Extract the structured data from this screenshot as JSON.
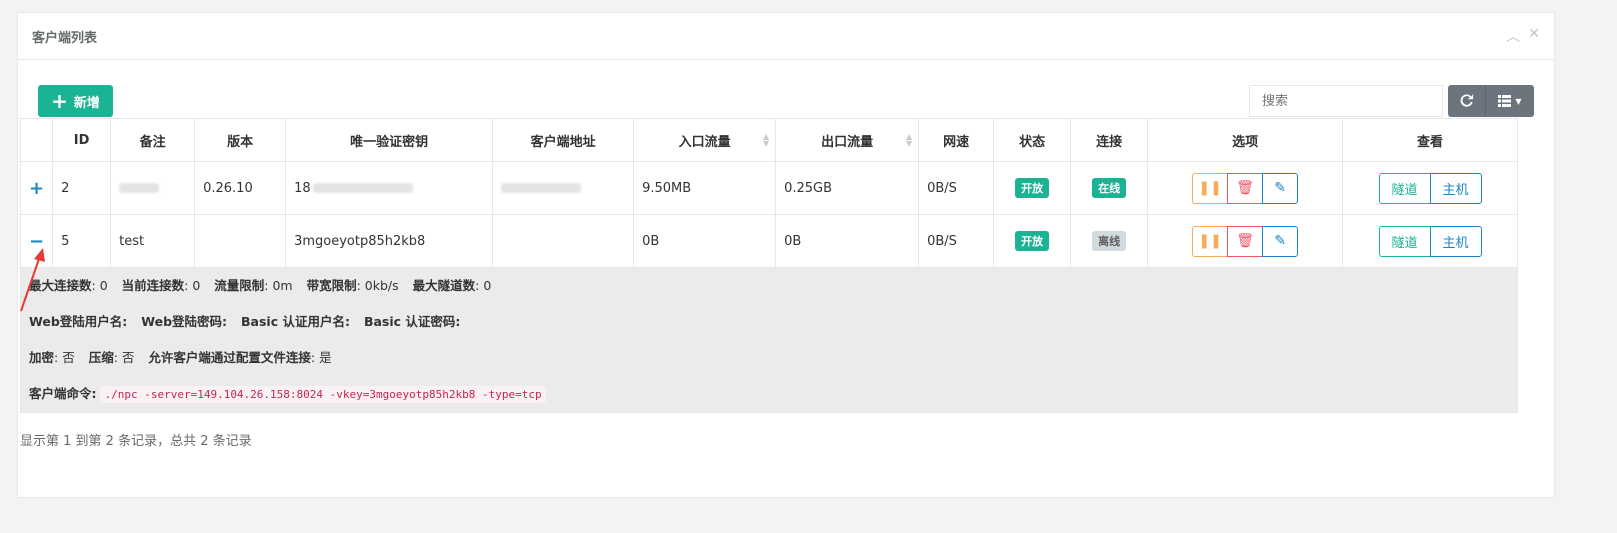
{
  "panel": {
    "title": "客户端列表",
    "collapse_icon": "chevron-up-icon",
    "close_icon": "close-icon"
  },
  "toolbar": {
    "add_label": "新增",
    "search_placeholder": "搜索"
  },
  "table": {
    "headers": [
      "",
      "ID",
      "备注",
      "版本",
      "唯一验证密钥",
      "客户端地址",
      "入口流量",
      "出口流量",
      "网速",
      "状态",
      "连接",
      "选项",
      "查看"
    ],
    "rows": [
      {
        "expander": "+",
        "id": "2",
        "remark": "",
        "version": "0.26.10",
        "key": "18",
        "address": "",
        "in": "9.50MB",
        "out": "0.25GB",
        "speed": "0B/S",
        "status": "开放",
        "conn": "在线",
        "tunnel": "隧道",
        "host": "主机"
      },
      {
        "expander": "−",
        "id": "5",
        "remark": "test",
        "version": "",
        "key": "3mgoeyotp85h2kb8",
        "address": "",
        "in": "0B",
        "out": "0B",
        "speed": "0B/S",
        "status": "开放",
        "conn": "离线",
        "tunnel": "隧道",
        "host": "主机"
      }
    ],
    "detail": {
      "max_conn_label": "最大连接数",
      "max_conn": ": 0",
      "cur_conn_label": "当前连接数",
      "cur_conn": ": 0",
      "flow_limit_label": "流量限制",
      "flow_limit": ": 0m",
      "bw_limit_label": "带宽限制",
      "bw_limit": ": 0kb/s",
      "max_tunnel_label": "最大隧道数",
      "max_tunnel": ": 0",
      "web_user_label": "Web登陆用户名:",
      "web_pass_label": "Web登陆密码:",
      "basic_user_label": "Basic 认证用户名:",
      "basic_pass_label": "Basic 认证密码:",
      "encrypt_label": "加密",
      "encrypt": ": 否",
      "compress_label": "压缩",
      "compress": ": 否",
      "allow_cfg_label": "允许客户端通过配置文件连接",
      "allow_cfg": ": 是",
      "cmd_label": "客户端命令:",
      "cmd": "./npc -server=149.104.26.158:8024 -vkey=3mgoeyotp85h2kb8 -type=tcp"
    }
  },
  "footer": {
    "info": "显示第 1 到第 2 条记录，总共 2 条记录"
  },
  "colors": {
    "primary": "#1ab394",
    "warning": "#f8ac59",
    "danger": "#ed5565",
    "info": "#1c84c6"
  }
}
